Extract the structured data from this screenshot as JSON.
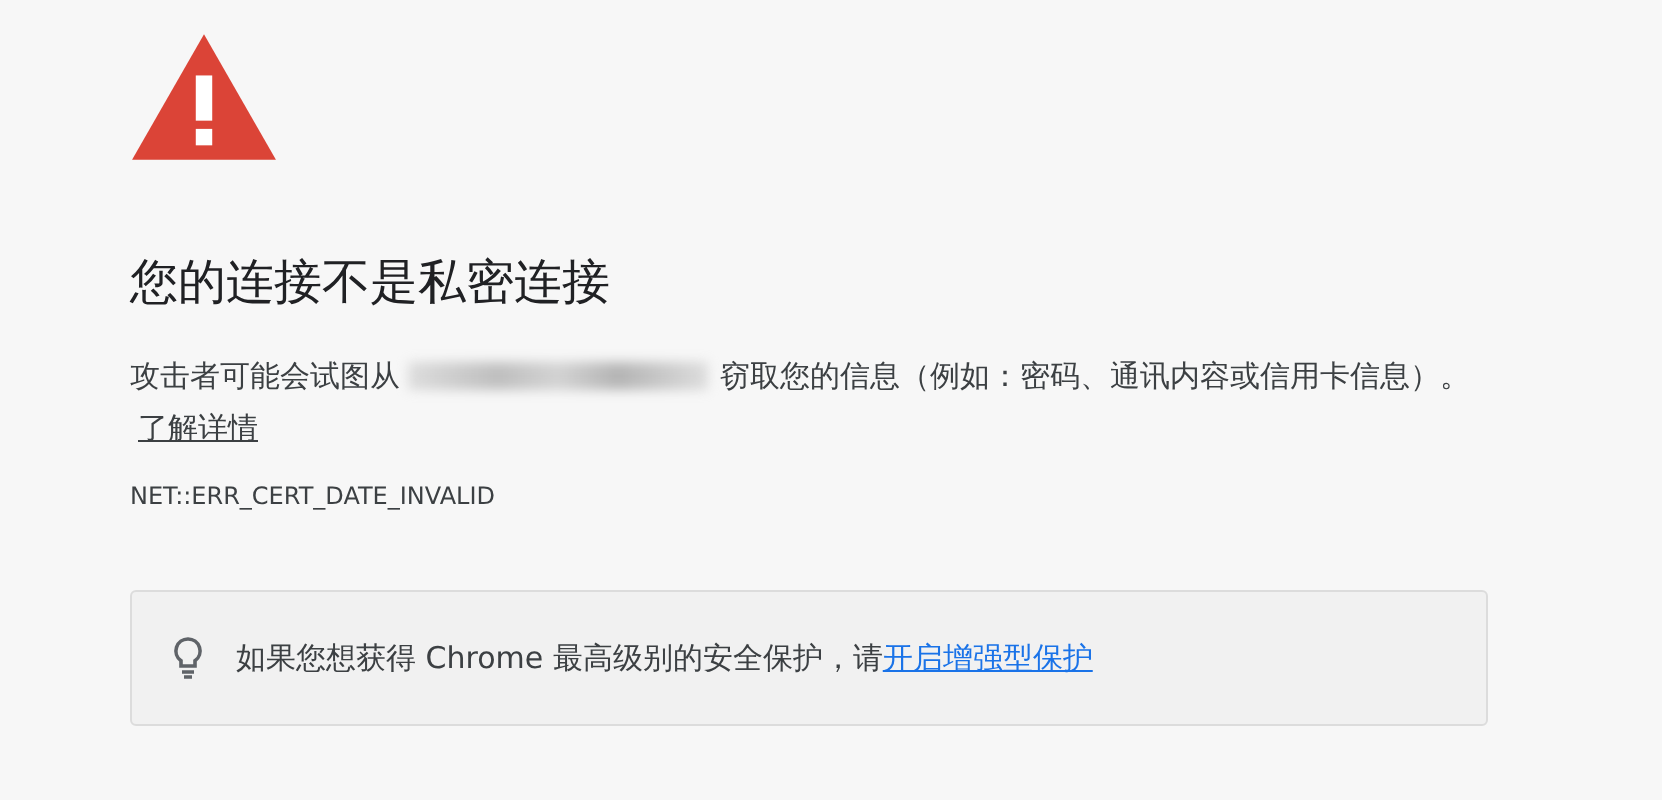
{
  "heading": "您的连接不是私密连接",
  "message": {
    "before": "攻击者可能会试图从",
    "after": "窃取您的信息（例如：密码、通讯内容或信用卡信息）。",
    "link": "了解详情"
  },
  "error_code": "NET::ERR_CERT_DATE_INVALID",
  "tip": {
    "text": "如果您想获得 Chrome 最高级别的安全保护，请",
    "link": "开启增强型保护"
  }
}
